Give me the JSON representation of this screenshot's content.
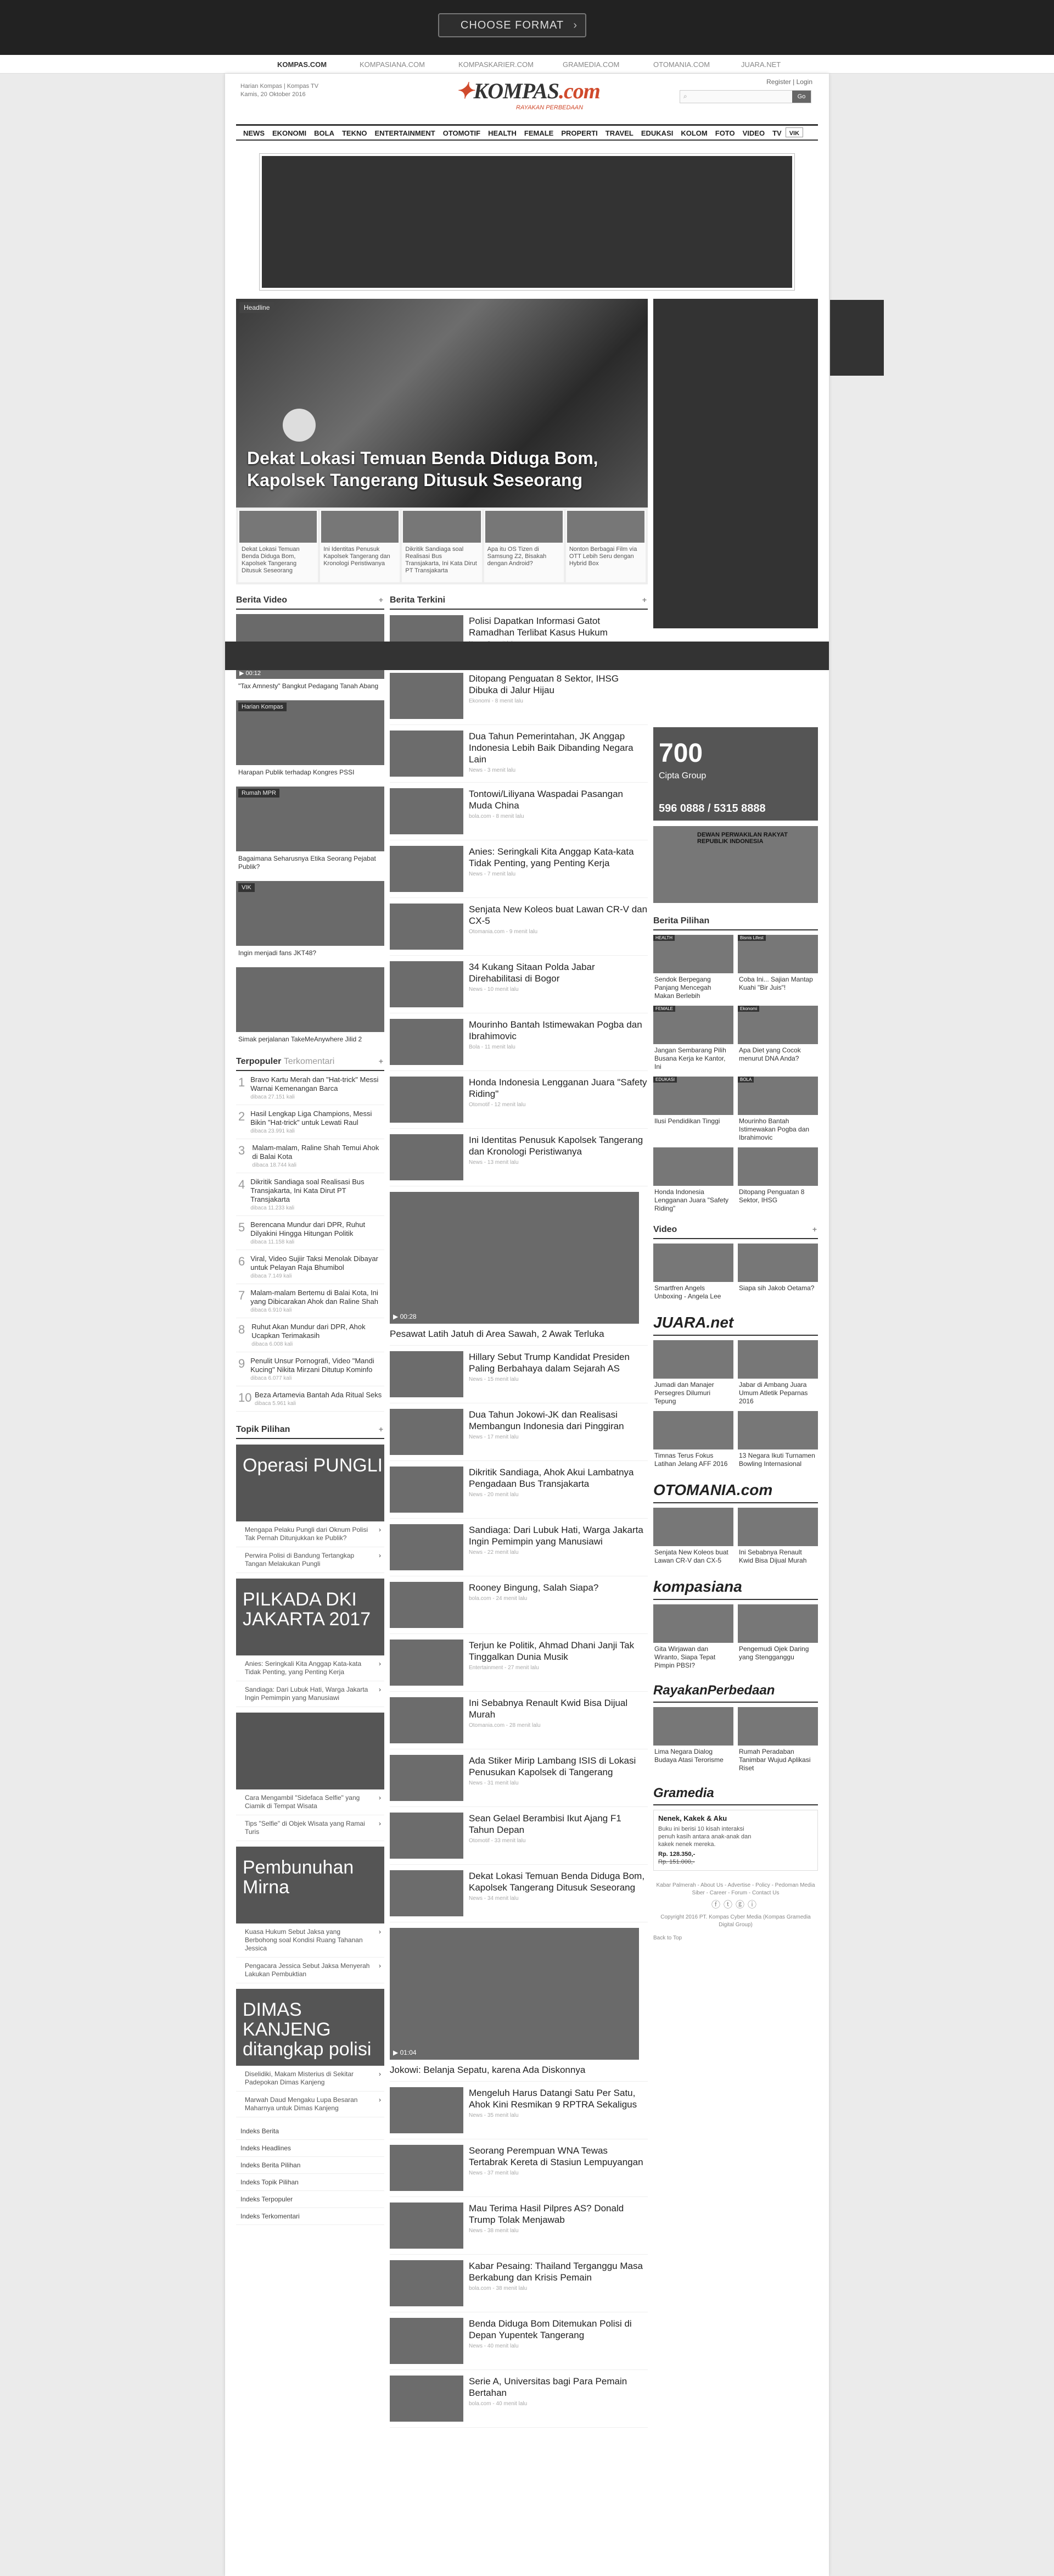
{
  "topbar": {
    "format_button": "CHOOSE FORMAT"
  },
  "network": [
    "KOMPAS.COM",
    "KOMPASIANA.COM",
    "KOMPASKARIER.COM",
    "GRAMEDIA.COM",
    "OTOMANIA.COM",
    "JUARA.NET"
  ],
  "header": {
    "line1": "Harian Kompas | Kompas TV",
    "date": "Kamis, 20 Oktober 2016",
    "logo_main": "KOMPAS",
    "logo_dot": ".com",
    "tagline": "RAYAKAN PERBEDAAN",
    "register": "Register",
    "login": "Login",
    "search_go": "Go"
  },
  "nav": [
    "NEWS",
    "EKONOMI",
    "BOLA",
    "TEKNO",
    "ENTERTAINMENT",
    "OTOMOTIF",
    "HEALTH",
    "FEMALE",
    "PROPERTI",
    "TRAVEL",
    "EDUKASI",
    "KOLOM",
    "FOTO",
    "VIDEO",
    "TV",
    "VIK"
  ],
  "headline": {
    "tag": "Headline",
    "title": "Dekat Lokasi Temuan Benda Diduga Bom, Kapolsek Tangerang Ditusuk Seseorang",
    "thumbs": [
      "Dekat Lokasi Temuan Benda Diduga Bom, Kapolsek Tangerang Ditusuk Seseorang",
      "Ini Identitas Penusuk Kapolsek Tangerang dan Kronologi Peristiwanya",
      "Dikritik Sandiaga soal Realisasi Bus Transjakarta, Ini Kata Dirut PT Transjakarta",
      "Apa itu OS Tizen di Samsung Z2, Bisakah dengan Android?",
      "Nonton Berbagai Film via OTT Lebih Seru dengan Hybrid Box"
    ]
  },
  "berita_video": {
    "title": "Berita Video",
    "items": [
      {
        "label": "",
        "duration": "00:12",
        "caption": "\"Tax Amnesty\" Bangkut Pedagang Tanah Abang"
      },
      {
        "label": "Harian Kompas",
        "duration": "",
        "caption": "Harapan Publik terhadap Kongres PSSI"
      },
      {
        "label": "Rumah MPR",
        "duration": "",
        "caption": "Bagaimana Seharusnya Etika Seorang Pejabat Publik?"
      },
      {
        "label": "VIK",
        "duration": "",
        "caption": "Ingin menjadi fans JKT48?"
      },
      {
        "label": "",
        "duration": "",
        "caption": "Simak perjalanan TakeMeAnywhere Jilid 2"
      }
    ]
  },
  "terpopuler": {
    "title": "Terpopuler",
    "alt": "Terkomentari",
    "items": [
      {
        "n": "1",
        "t": "Bravo Kartu Merah dan \"Hat-trick\" Messi Warnai Kemenangan Barca",
        "m": "dibaca 27.151 kali"
      },
      {
        "n": "2",
        "t": "Hasil Lengkap Liga Champions, Messi Bikin \"Hat-trick\" untuk Lewati Raul",
        "m": "dibaca 23.991 kali"
      },
      {
        "n": "3",
        "t": "Malam-malam, Raline Shah Temui Ahok di Balai Kota",
        "m": "dibaca 18.744 kali"
      },
      {
        "n": "4",
        "t": "Dikritik Sandiaga soal Realisasi Bus Transjakarta, Ini Kata Dirut PT Transjakarta",
        "m": "dibaca 11.233 kali"
      },
      {
        "n": "5",
        "t": "Berencana Mundur dari DPR, Ruhut Dilyakini Hingga Hitungan Politik",
        "m": "dibaca 11.158 kali"
      },
      {
        "n": "6",
        "t": "Viral, Video Sujiir Taksi Menolak Dibayar untuk Pelayan Raja Bhumibol",
        "m": "dibaca 7.149 kali"
      },
      {
        "n": "7",
        "t": "Malam-malam Bertemu di Balai Kota, Ini yang Dibicarakan Ahok dan Raline Shah",
        "m": "dibaca 6.910 kali"
      },
      {
        "n": "8",
        "t": "Ruhut Akan Mundur dari DPR, Ahok Ucapkan Terimakasih",
        "m": "dibaca 6.008 kali"
      },
      {
        "n": "9",
        "t": "Penulit Unsur Pornografi, Video \"Mandi Kucing\" Nikita Mirzani Ditutup Kominfo",
        "m": "dibaca 6.077 kali"
      },
      {
        "n": "10",
        "t": "Beza Artamevia Bantah Ada Ritual Seks",
        "m": "dibaca 5.961 kali"
      }
    ]
  },
  "topik": {
    "title": "Topik Pilihan",
    "blocks": [
      {
        "cap": "Operasi PUNGLI",
        "links": [
          "Mengapa Pelaku Pungli dari Oknum Polisi Tak Pernah Ditunjukkan ke Publik?",
          "Perwira Polisi di Bandung Tertangkap Tangan Melakukan Pungli"
        ]
      },
      {
        "cap": "PILKADA DKI JAKARTA 2017",
        "links": [
          "Anies: Seringkali Kita Anggap Kata-kata Tidak Penting, yang Penting Kerja",
          "Sandiaga: Dari Lubuk Hati, Warga Jakarta Ingin Pemimpin yang Manusiawi"
        ]
      },
      {
        "cap": "",
        "links": [
          "Cara Mengambil \"Sidefaca Selfie\" yang Ciamik di Tempat Wisata",
          "Tips \"Selfie\" di Objek Wisata yang Ramai Turis"
        ]
      },
      {
        "cap": "Pembunuhan Mirna",
        "links": [
          "Kuasa Hukum Sebut Jaksa yang Berbohong soal Kondisi Ruang Tahanan Jessica",
          "Pengacara Jessica Sebut Jaksa Menyerah Lakukan Pembuktian"
        ]
      },
      {
        "cap": "DIMAS KANJENG ditangkap polisi",
        "links": [
          "Diselidiki, Makam Misterius di Sekitar Padepokan Dimas Kanjeng",
          "Marwah Daud Mengaku Lupa Besaran Maharnya untuk Dimas Kanjeng"
        ]
      }
    ]
  },
  "index_links": [
    "Indeks Berita",
    "Indeks Headlines",
    "Indeks Berita Pilihan",
    "Indeks Topik Pilihan",
    "Indeks Terpopuler",
    "Indeks Terkomentari"
  ],
  "berita_terkini": {
    "title": "Berita Terkini",
    "items": [
      {
        "t": "Polisi Dapatkan Informasi Gatot Ramadhan Terlibat Kasus Hukum",
        "m": "News - 0 menit lalu",
        "big": false,
        "dur": ""
      },
      {
        "t": "Ditopang Penguatan 8 Sektor, IHSG Dibuka di Jalur Hijau",
        "m": "Ekonomi - 8 menit lalu",
        "big": false,
        "dur": ""
      },
      {
        "t": "Dua Tahun Pemerintahan, JK Anggap Indonesia Lebih Baik Dibanding Negara Lain",
        "m": "News - 3 menit lalu",
        "big": false,
        "dur": ""
      },
      {
        "t": "Tontowi/Liliyana Waspadai Pasangan Muda China",
        "m": "bola.com - 8 menit lalu",
        "big": false,
        "dur": ""
      },
      {
        "t": "Anies: Seringkali Kita Anggap Kata-kata Tidak Penting, yang Penting Kerja",
        "m": "News - 7 menit lalu",
        "big": false,
        "dur": ""
      },
      {
        "t": "Senjata New Koleos buat Lawan CR-V dan CX-5",
        "m": "Otomania.com - 9 menit lalu",
        "big": false,
        "dur": ""
      },
      {
        "t": "34 Kukang Sitaan Polda Jabar Direhabilitasi di Bogor",
        "m": "News - 10 menit lalu",
        "big": false,
        "dur": ""
      },
      {
        "t": "Mourinho Bantah Istimewakan Pogba dan Ibrahimovic",
        "m": "Bola - 11 menit lalu",
        "big": false,
        "dur": ""
      },
      {
        "t": "Honda Indonesia Lengganan Juara \"Safety Riding\"",
        "m": "Otomotif - 12 menit lalu",
        "big": false,
        "dur": ""
      },
      {
        "t": "Ini Identitas Penusuk Kapolsek Tangerang dan Kronologi Peristiwanya",
        "m": "News - 13 menit lalu",
        "big": false,
        "dur": ""
      },
      {
        "t": "Pesawat Latih Jatuh di Area Sawah, 2 Awak Terluka",
        "m": "",
        "big": true,
        "dur": "00:28"
      },
      {
        "t": "Hillary Sebut Trump Kandidat Presiden Paling Berbahaya dalam Sejarah AS",
        "m": "News - 15 menit lalu",
        "big": false,
        "dur": ""
      },
      {
        "t": "Dua Tahun Jokowi-JK dan Realisasi Membangun Indonesia dari Pinggiran",
        "m": "News - 17 menit lalu",
        "big": false,
        "dur": ""
      },
      {
        "t": "Dikritik Sandiaga, Ahok Akui Lambatnya Pengadaan Bus Transjakarta",
        "m": "News - 20 menit lalu",
        "big": false,
        "dur": ""
      },
      {
        "t": "Sandiaga: Dari Lubuk Hati, Warga Jakarta Ingin Pemimpin yang Manusiawi",
        "m": "News - 22 menit lalu",
        "big": false,
        "dur": ""
      },
      {
        "t": "Rooney Bingung, Salah Siapa?",
        "m": "bola.com - 24 menit lalu",
        "big": false,
        "dur": ""
      },
      {
        "t": "Terjun ke Politik, Ahmad Dhani Janji Tak Tinggalkan Dunia Musik",
        "m": "Entertainment - 27 menit lalu",
        "big": false,
        "dur": ""
      },
      {
        "t": "Ini Sebabnya Renault Kwid Bisa Dijual Murah",
        "m": "Otomania.com - 28 menit lalu",
        "big": false,
        "dur": ""
      },
      {
        "t": "Ada Stiker Mirip Lambang ISIS di Lokasi Penusukan Kapolsek di Tangerang",
        "m": "News - 31 menit lalu",
        "big": false,
        "dur": ""
      },
      {
        "t": "Sean Gelael Berambisi Ikut Ajang F1 Tahun Depan",
        "m": "Otomotif - 33 menit lalu",
        "big": false,
        "dur": ""
      },
      {
        "t": "Dekat Lokasi Temuan Benda Diduga Bom, Kapolsek Tangerang Ditusuk Seseorang",
        "m": "News - 34 menit lalu",
        "big": false,
        "dur": ""
      },
      {
        "t": "Jokowi: Belanja Sepatu, karena Ada Diskonnya",
        "m": "",
        "big": true,
        "dur": "01:04"
      },
      {
        "t": "Mengeluh Harus Datangi Satu Per Satu, Ahok Kini Resmikan 9 RPTRA Sekaligus",
        "m": "News - 35 menit lalu",
        "big": false,
        "dur": ""
      },
      {
        "t": "Seorang Perempuan WNA Tewas Tertabrak Kereta di Stasiun Lempuyangan",
        "m": "News - 37 menit lalu",
        "big": false,
        "dur": ""
      },
      {
        "t": "Mau Terima Hasil Pilpres AS? Donald Trump Tolak Menjawab",
        "m": "News - 38 menit lalu",
        "big": false,
        "dur": ""
      },
      {
        "t": "Kabar Pesaing: Thailand Terganggu Masa Berkabung dan Krisis Pemain",
        "m": "bola.com - 38 menit lalu",
        "big": false,
        "dur": ""
      },
      {
        "t": "Benda Diduga Bom Ditemukan Polisi di Depan Yupentek Tangerang",
        "m": "News - 40 menit lalu",
        "big": false,
        "dur": ""
      },
      {
        "t": "Serie A, Universitas bagi Para Pemain Bertahan",
        "m": "bola.com - 40 menit lalu",
        "big": false,
        "dur": ""
      }
    ]
  },
  "right_ads": {
    "phone_number": "596 0888 / 5315 8888",
    "dpr_label": "DEWAN PERWAKILAN RAKYAT REPUBLIK INDONESIA",
    "phone_big": "700",
    "phone_sub": "Cipta Group"
  },
  "berita_pilihan": {
    "title": "Berita Pilihan",
    "items": [
      {
        "l": "HEALTH",
        "t": "Sendok Berpegang Panjang Mencegah Makan Berlebih"
      },
      {
        "l": "Bisnis Lifest",
        "t": "Coba Ini... Sajian Mantap Kuahi \"Bir Juis\"!"
      },
      {
        "l": "FEMALE",
        "t": "Jangan Sembarang Pilih Busana Kerja ke Kantor, Ini"
      },
      {
        "l": "Ekonomi",
        "t": "Apa Diet yang Cocok menurut DNA Anda?"
      },
      {
        "l": "EDUKASI",
        "t": "Ilusi Pendidikan Tinggi"
      },
      {
        "l": "BOLA",
        "t": "Mourinho Bantah Istimewakan Pogba dan Ibrahimovic"
      },
      {
        "l": "",
        "t": "Honda Indonesia Lengganan Juara \"Safety Riding\""
      },
      {
        "l": "",
        "t": "Ditopang Penguatan 8 Sektor, IHSG"
      }
    ]
  },
  "video_side": {
    "title": "Video",
    "items": [
      "Smartfren Angels Unboxing - Angela Lee",
      "Siapa sih Jakob Oetama?"
    ]
  },
  "juara": {
    "brand": "JUARA.net",
    "items": [
      "Jumadi dan Manajer Persegres Dilumuri Tepung",
      "Jabar di Ambang Juara Umum Atletik Peparnas 2016",
      "Timnas Terus Fokus Latihan Jelang AFF 2016",
      "13 Negara Ikuti Turnamen Bowling Internasional"
    ]
  },
  "otomania": {
    "brand": "OTOMANIA.com",
    "items": [
      "Senjata New Koleos buat Lawan CR-V dan CX-5",
      "Ini Sebabnya Renault Kwid Bisa Dijual Murah"
    ]
  },
  "kompasiana": {
    "brand": "kompasiana",
    "items": [
      "Gita Wirjawan dan Wiranto, Siapa Tepat Pimpin PBSI?",
      "Pengemudi Ojek Daring yang Stengganggu"
    ]
  },
  "rayakan": {
    "brand": "RayakanPerbedaan",
    "items": [
      "Lima Negara Dialog Budaya Atasi Terorisme",
      "Rumah Peradaban Tanimbar Wujud Aplikasi Riset"
    ]
  },
  "gramedia": {
    "brand": "Gramedia",
    "book": "Nenek, Kakek & Aku",
    "desc": "Buku ini berisi 10 kisah interaksi penuh kasih antara anak-anak dan kakek nenek mereka.",
    "price": "Rp. 128.350,-",
    "old": "Rp. 151.000,-"
  },
  "footer": {
    "links": "Kabar Palmerah - About Us - Advertise - Policy - Pedoman Media Siber - Career - Forum - Contact Us",
    "copy": "Copyright 2016 PT. Kompas Cyber Media (Kompas Gramedia Digital Group)",
    "back": "Back to Top"
  }
}
